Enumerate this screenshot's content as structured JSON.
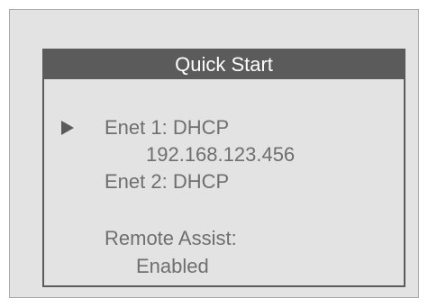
{
  "screen": {
    "title": "Quick Start",
    "selector_icon": "play-right-arrow-icon",
    "lines": {
      "enet1": "Enet 1:  DHCP",
      "enet1_ip": "192.168.123.456",
      "enet2": "Enet 2:  DHCP",
      "remote_assist_label": "Remote Assist:",
      "remote_assist_value": "Enabled"
    }
  },
  "colors": {
    "screen_background": "#e3e3e3",
    "title_bar": "#5b5b5b",
    "text": "#6f6f6f",
    "title_text": "#ffffff"
  }
}
